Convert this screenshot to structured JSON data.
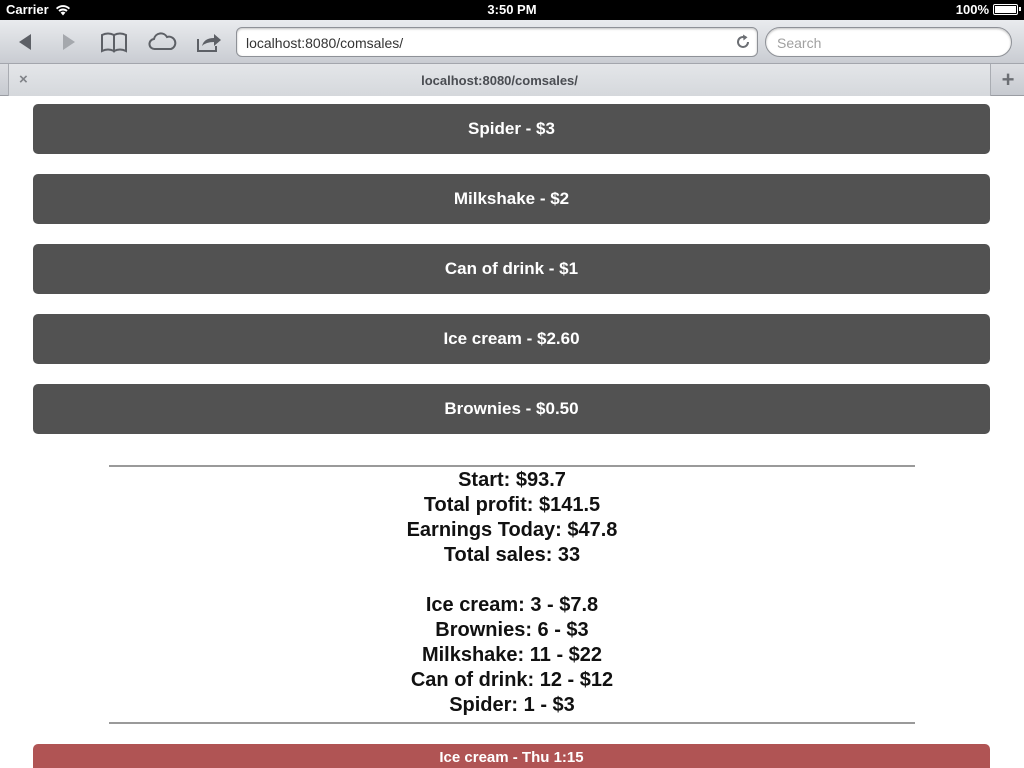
{
  "statusbar": {
    "carrier": "Carrier",
    "time": "3:50 PM",
    "battery": "100%",
    "battery_level": 1.0
  },
  "browser": {
    "url": "localhost:8080/comsales/",
    "search_placeholder": "Search",
    "tab_title": "localhost:8080/comsales/",
    "tab_close": "×",
    "new_tab": "+"
  },
  "items": [
    {
      "label": "Spider - $3"
    },
    {
      "label": "Milkshake - $2"
    },
    {
      "label": "Can of drink - $1"
    },
    {
      "label": "Ice cream - $2.60"
    },
    {
      "label": "Brownies - $0.50"
    }
  ],
  "summary": {
    "start": "Start: $93.7",
    "total_profit": "Total profit: $141.5",
    "earnings_today": "Earnings Today: $47.8",
    "total_sales": "Total sales: 33"
  },
  "breakdown": [
    "Ice cream: 3 - $7.8",
    "Brownies: 6 - $3",
    "Milkshake: 11 - $22",
    "Can of drink: 12 - $12",
    "Spider: 1 - $3"
  ],
  "recent": {
    "label": "Ice cream - Thu 1:15"
  },
  "colors": {
    "item_button": "#525252",
    "recent_sale": "#b05454"
  }
}
